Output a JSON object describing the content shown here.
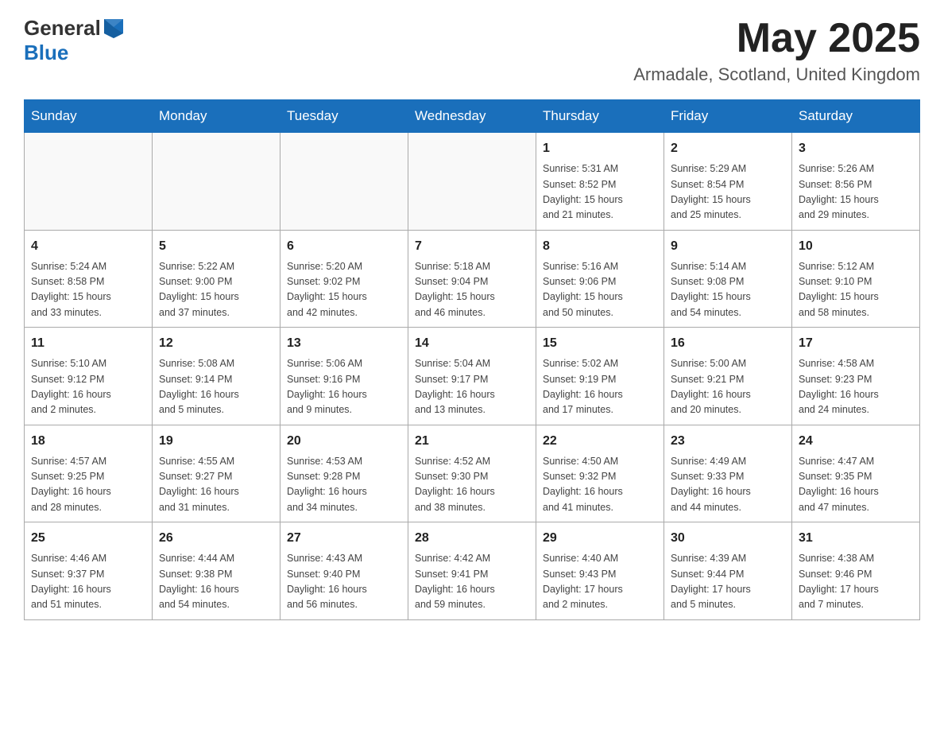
{
  "header": {
    "logo_general": "General",
    "logo_blue": "Blue",
    "month_title": "May 2025",
    "location": "Armadale, Scotland, United Kingdom"
  },
  "weekdays": [
    "Sunday",
    "Monday",
    "Tuesday",
    "Wednesday",
    "Thursday",
    "Friday",
    "Saturday"
  ],
  "weeks": [
    [
      {
        "day": "",
        "info": ""
      },
      {
        "day": "",
        "info": ""
      },
      {
        "day": "",
        "info": ""
      },
      {
        "day": "",
        "info": ""
      },
      {
        "day": "1",
        "info": "Sunrise: 5:31 AM\nSunset: 8:52 PM\nDaylight: 15 hours\nand 21 minutes."
      },
      {
        "day": "2",
        "info": "Sunrise: 5:29 AM\nSunset: 8:54 PM\nDaylight: 15 hours\nand 25 minutes."
      },
      {
        "day": "3",
        "info": "Sunrise: 5:26 AM\nSunset: 8:56 PM\nDaylight: 15 hours\nand 29 minutes."
      }
    ],
    [
      {
        "day": "4",
        "info": "Sunrise: 5:24 AM\nSunset: 8:58 PM\nDaylight: 15 hours\nand 33 minutes."
      },
      {
        "day": "5",
        "info": "Sunrise: 5:22 AM\nSunset: 9:00 PM\nDaylight: 15 hours\nand 37 minutes."
      },
      {
        "day": "6",
        "info": "Sunrise: 5:20 AM\nSunset: 9:02 PM\nDaylight: 15 hours\nand 42 minutes."
      },
      {
        "day": "7",
        "info": "Sunrise: 5:18 AM\nSunset: 9:04 PM\nDaylight: 15 hours\nand 46 minutes."
      },
      {
        "day": "8",
        "info": "Sunrise: 5:16 AM\nSunset: 9:06 PM\nDaylight: 15 hours\nand 50 minutes."
      },
      {
        "day": "9",
        "info": "Sunrise: 5:14 AM\nSunset: 9:08 PM\nDaylight: 15 hours\nand 54 minutes."
      },
      {
        "day": "10",
        "info": "Sunrise: 5:12 AM\nSunset: 9:10 PM\nDaylight: 15 hours\nand 58 minutes."
      }
    ],
    [
      {
        "day": "11",
        "info": "Sunrise: 5:10 AM\nSunset: 9:12 PM\nDaylight: 16 hours\nand 2 minutes."
      },
      {
        "day": "12",
        "info": "Sunrise: 5:08 AM\nSunset: 9:14 PM\nDaylight: 16 hours\nand 5 minutes."
      },
      {
        "day": "13",
        "info": "Sunrise: 5:06 AM\nSunset: 9:16 PM\nDaylight: 16 hours\nand 9 minutes."
      },
      {
        "day": "14",
        "info": "Sunrise: 5:04 AM\nSunset: 9:17 PM\nDaylight: 16 hours\nand 13 minutes."
      },
      {
        "day": "15",
        "info": "Sunrise: 5:02 AM\nSunset: 9:19 PM\nDaylight: 16 hours\nand 17 minutes."
      },
      {
        "day": "16",
        "info": "Sunrise: 5:00 AM\nSunset: 9:21 PM\nDaylight: 16 hours\nand 20 minutes."
      },
      {
        "day": "17",
        "info": "Sunrise: 4:58 AM\nSunset: 9:23 PM\nDaylight: 16 hours\nand 24 minutes."
      }
    ],
    [
      {
        "day": "18",
        "info": "Sunrise: 4:57 AM\nSunset: 9:25 PM\nDaylight: 16 hours\nand 28 minutes."
      },
      {
        "day": "19",
        "info": "Sunrise: 4:55 AM\nSunset: 9:27 PM\nDaylight: 16 hours\nand 31 minutes."
      },
      {
        "day": "20",
        "info": "Sunrise: 4:53 AM\nSunset: 9:28 PM\nDaylight: 16 hours\nand 34 minutes."
      },
      {
        "day": "21",
        "info": "Sunrise: 4:52 AM\nSunset: 9:30 PM\nDaylight: 16 hours\nand 38 minutes."
      },
      {
        "day": "22",
        "info": "Sunrise: 4:50 AM\nSunset: 9:32 PM\nDaylight: 16 hours\nand 41 minutes."
      },
      {
        "day": "23",
        "info": "Sunrise: 4:49 AM\nSunset: 9:33 PM\nDaylight: 16 hours\nand 44 minutes."
      },
      {
        "day": "24",
        "info": "Sunrise: 4:47 AM\nSunset: 9:35 PM\nDaylight: 16 hours\nand 47 minutes."
      }
    ],
    [
      {
        "day": "25",
        "info": "Sunrise: 4:46 AM\nSunset: 9:37 PM\nDaylight: 16 hours\nand 51 minutes."
      },
      {
        "day": "26",
        "info": "Sunrise: 4:44 AM\nSunset: 9:38 PM\nDaylight: 16 hours\nand 54 minutes."
      },
      {
        "day": "27",
        "info": "Sunrise: 4:43 AM\nSunset: 9:40 PM\nDaylight: 16 hours\nand 56 minutes."
      },
      {
        "day": "28",
        "info": "Sunrise: 4:42 AM\nSunset: 9:41 PM\nDaylight: 16 hours\nand 59 minutes."
      },
      {
        "day": "29",
        "info": "Sunrise: 4:40 AM\nSunset: 9:43 PM\nDaylight: 17 hours\nand 2 minutes."
      },
      {
        "day": "30",
        "info": "Sunrise: 4:39 AM\nSunset: 9:44 PM\nDaylight: 17 hours\nand 5 minutes."
      },
      {
        "day": "31",
        "info": "Sunrise: 4:38 AM\nSunset: 9:46 PM\nDaylight: 17 hours\nand 7 minutes."
      }
    ]
  ]
}
